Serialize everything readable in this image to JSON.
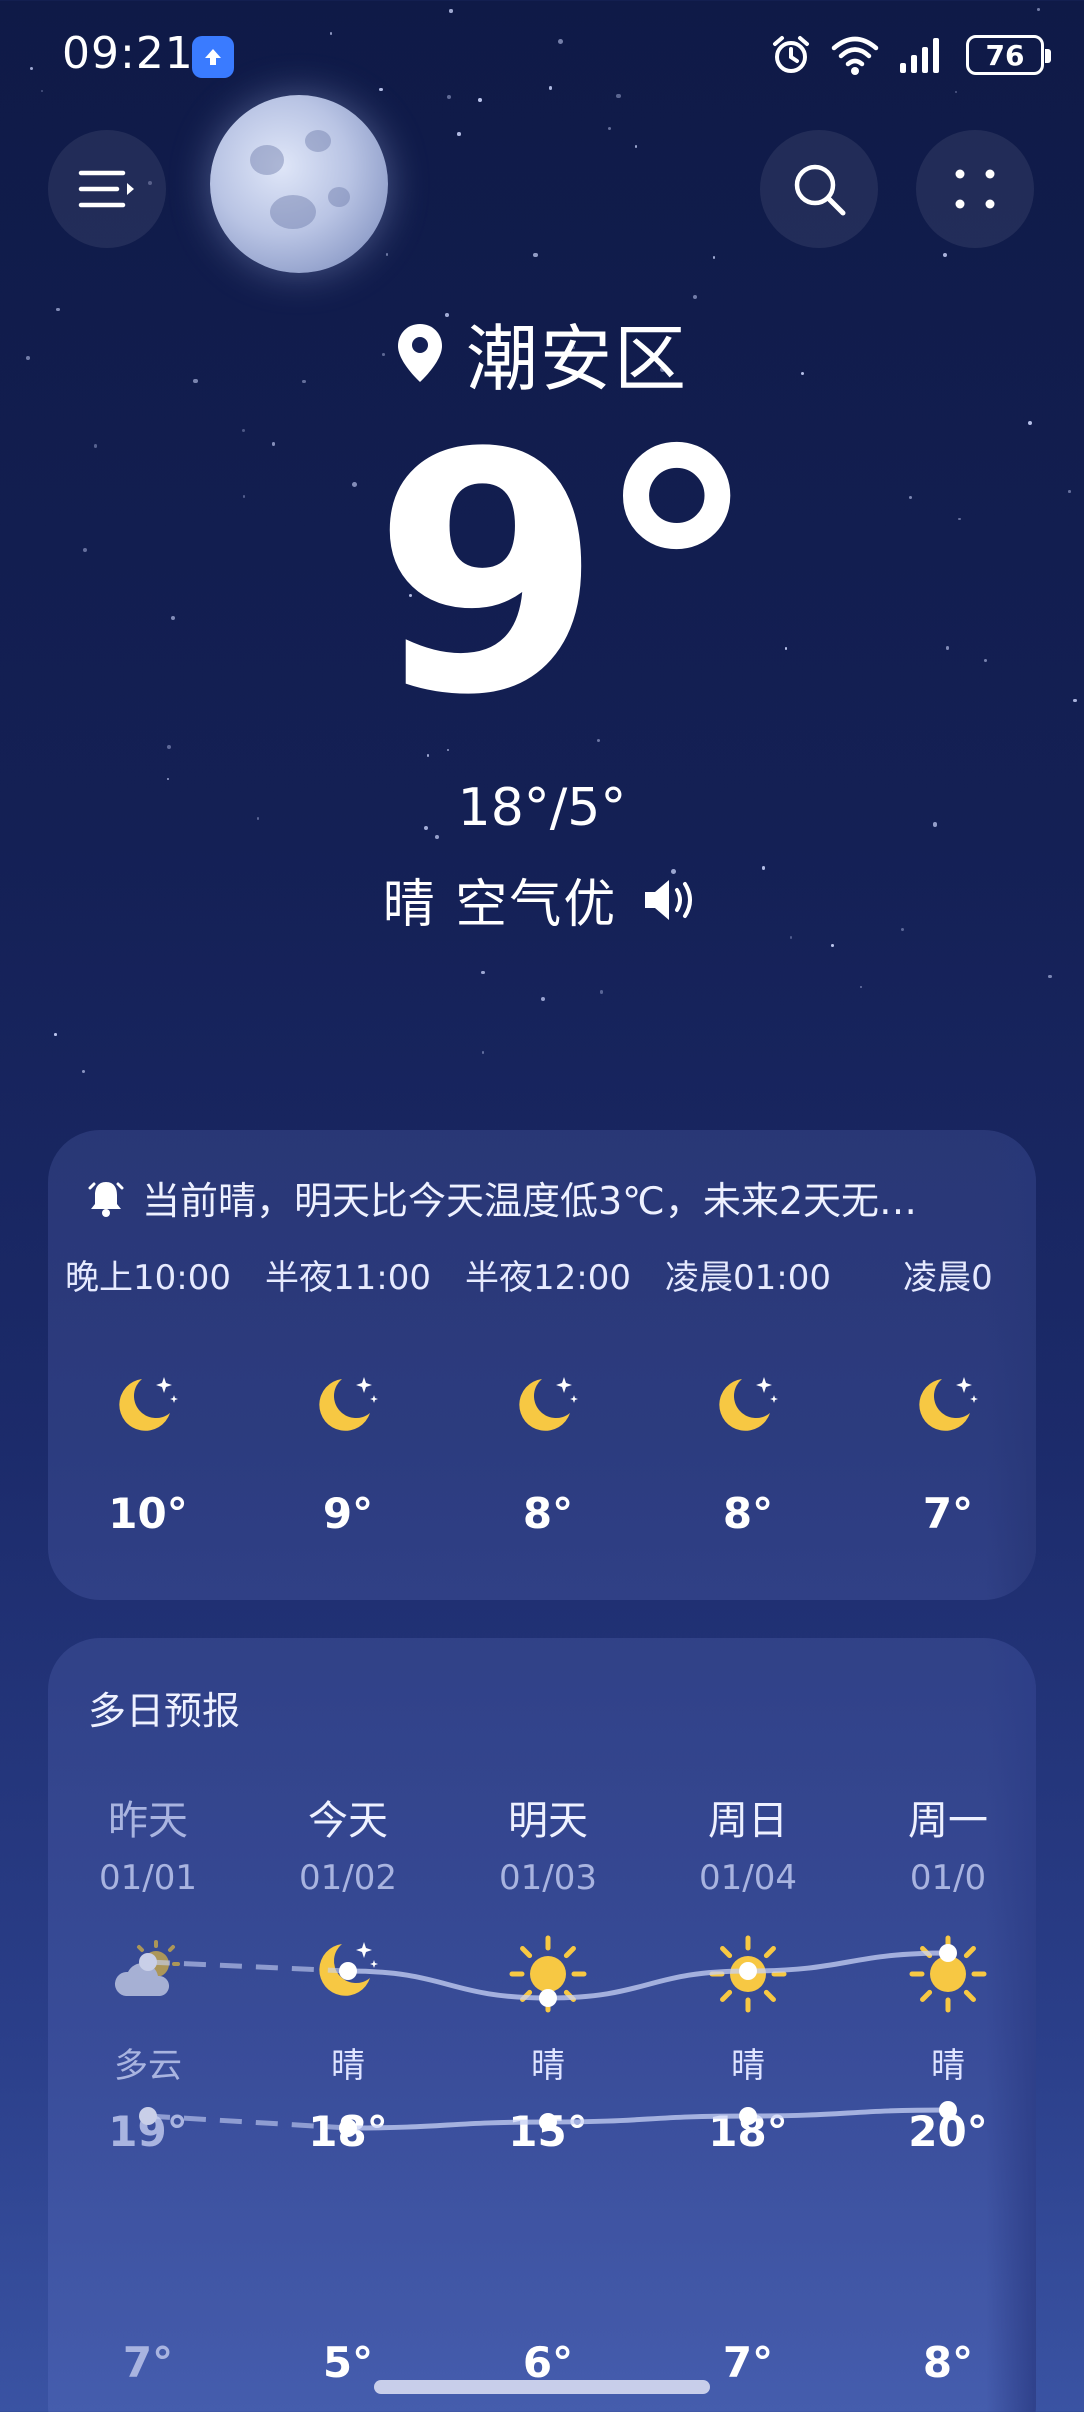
{
  "status_bar": {
    "time": "09:21",
    "battery": "76"
  },
  "header": {
    "location": "潮安区",
    "current_temp": "9°",
    "high_low": "18°/5°",
    "condition": "晴 空气优"
  },
  "hourly": {
    "alert": "当前晴，明天比今天温度低3℃，未来2天无…",
    "items": [
      {
        "time": "晚上10:00",
        "icon": "moon-stars-icon",
        "temp": "10°"
      },
      {
        "time": "半夜11:00",
        "icon": "moon-stars-icon",
        "temp": "9°"
      },
      {
        "time": "半夜12:00",
        "icon": "moon-stars-icon",
        "temp": "8°"
      },
      {
        "time": "凌晨01:00",
        "icon": "moon-stars-icon",
        "temp": "8°"
      },
      {
        "time": "凌晨0",
        "icon": "moon-stars-icon",
        "temp": "7°"
      }
    ]
  },
  "daily": {
    "title": "多日预报",
    "items": [
      {
        "day": "昨天",
        "date": "01/01",
        "icon": "partly-cloudy-icon",
        "condition": "多云",
        "high": "19°",
        "low": "7°",
        "high_value": 19,
        "low_value": 7
      },
      {
        "day": "今天",
        "date": "01/02",
        "icon": "moon-stars-icon",
        "condition": "晴",
        "high": "18°",
        "low": "5°",
        "high_value": 18,
        "low_value": 5
      },
      {
        "day": "明天",
        "date": "01/03",
        "icon": "sun-icon",
        "condition": "晴",
        "high": "15°",
        "low": "6°",
        "high_value": 15,
        "low_value": 6
      },
      {
        "day": "周日",
        "date": "01/04",
        "icon": "sun-icon",
        "condition": "晴",
        "high": "18°",
        "low": "7°",
        "high_value": 18,
        "low_value": 7
      },
      {
        "day": "周一",
        "date": "01/0",
        "icon": "sun-icon",
        "condition": "晴",
        "high": "20°",
        "low": "8°",
        "high_value": 20,
        "low_value": 8
      }
    ]
  },
  "colors": {
    "accent_yellow": "#f7c843",
    "background_top": "#0f1a47",
    "background_bottom": "#3a53a3"
  }
}
